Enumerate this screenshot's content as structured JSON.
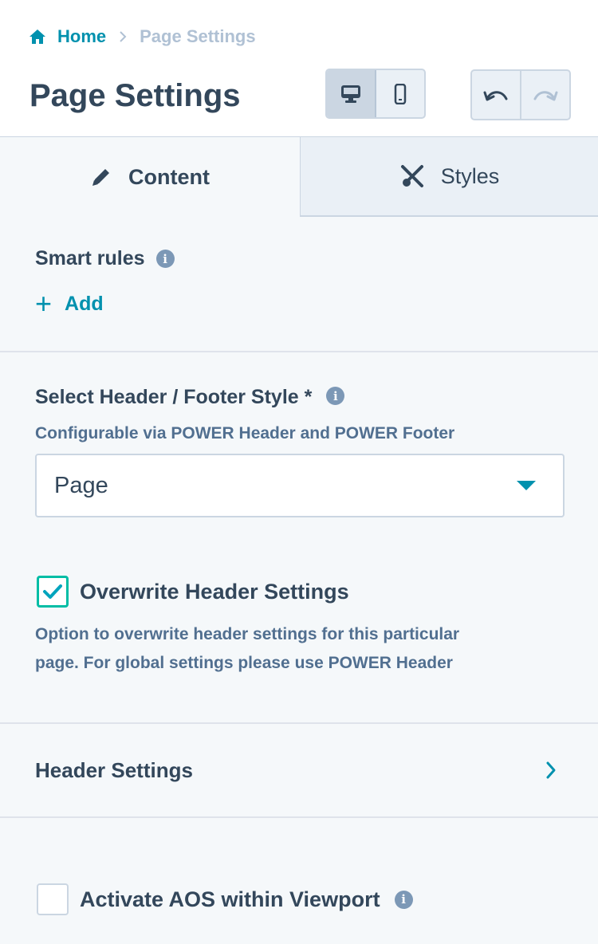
{
  "breadcrumb": {
    "home_label": "Home",
    "current_label": "Page Settings"
  },
  "page_title": "Page Settings",
  "device_toggle": {
    "selected": "desktop"
  },
  "tabs": [
    {
      "label": "Content",
      "icon": "pencil-icon",
      "active": true
    },
    {
      "label": "Styles",
      "icon": "brush-icon",
      "active": false
    }
  ],
  "smart_rules": {
    "label": "Smart rules",
    "add_label": "Add"
  },
  "header_footer": {
    "label": "Select Header / Footer Style *",
    "help": "Configurable via POWER Header and POWER Footer",
    "selected_value": "Page"
  },
  "overwrite_header": {
    "label": "Overwrite Header Settings",
    "checked": true,
    "help_line1": "Option to overwrite header settings for this particular",
    "help_line2": "page. For global settings please use POWER Header"
  },
  "header_settings": {
    "label": "Header Settings"
  },
  "aos": {
    "label": "Activate AOS within Viewport",
    "checked": false
  },
  "colors": {
    "accent": "#0091ae",
    "text": "#33475b",
    "muted": "#b0c1d4",
    "check": "#00bda5"
  }
}
